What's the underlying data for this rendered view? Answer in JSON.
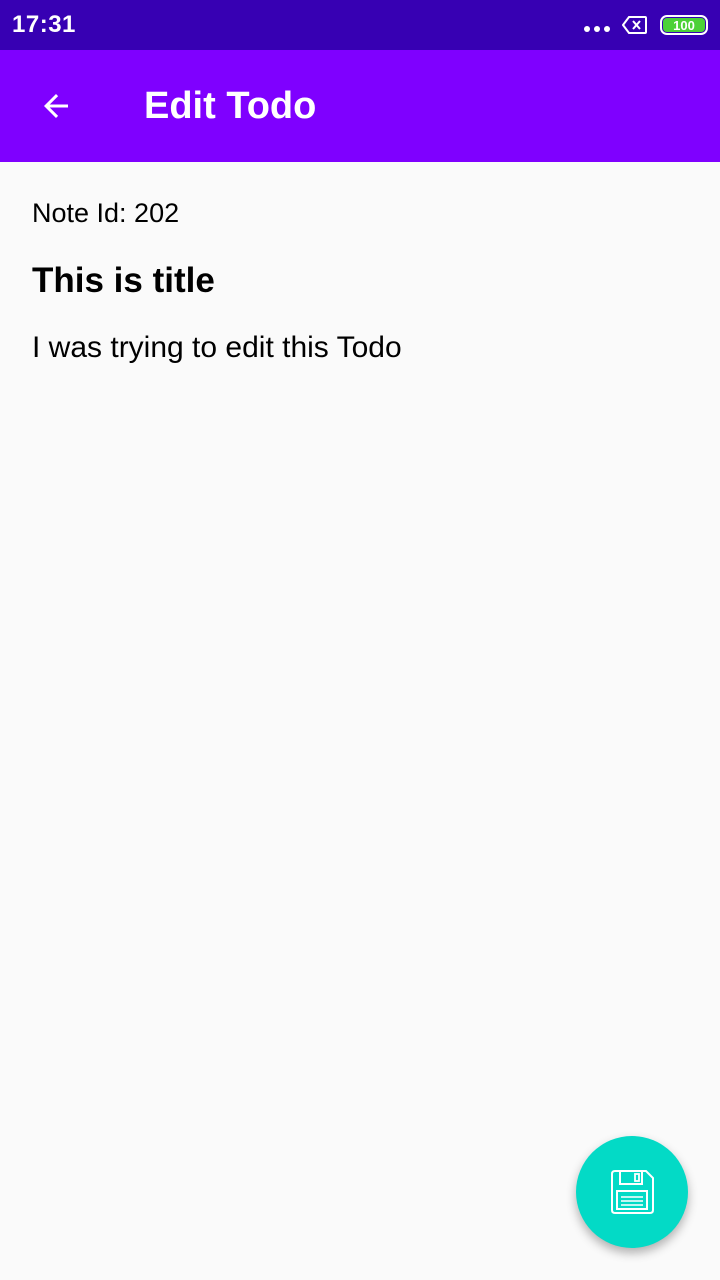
{
  "status_bar": {
    "time": "17:31",
    "battery": "100",
    "icons": [
      "more-dots-icon",
      "no-sim-icon",
      "battery-icon"
    ]
  },
  "app_bar": {
    "title": "Edit Todo",
    "back_icon": "arrow-back-icon"
  },
  "note": {
    "id_label": "Note Id: 202",
    "title": "This is title",
    "body": "I was trying to edit this Todo"
  },
  "fab": {
    "icon": "save-icon"
  },
  "colors": {
    "status_bar": "#3700b3",
    "app_bar": "#7f00ff",
    "fab": "#03dac6",
    "background": "#fafafa"
  }
}
